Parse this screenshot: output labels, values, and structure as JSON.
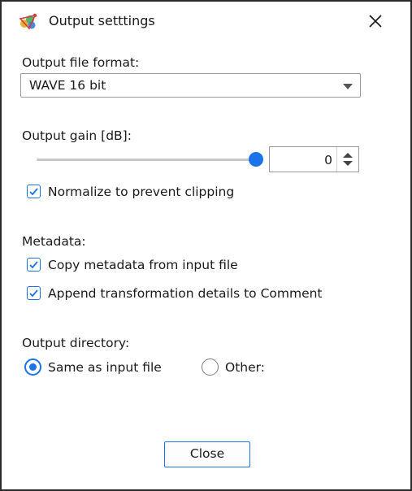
{
  "window": {
    "title": "Output setttings"
  },
  "output_format": {
    "label": "Output file format:",
    "selected": "WAVE 16 bit"
  },
  "output_gain": {
    "label": "Output gain [dB]:",
    "value": "0",
    "slider_fraction": 1.0
  },
  "normalize": {
    "label": "Normalize to prevent clipping",
    "checked": true
  },
  "metadata": {
    "label": "Metadata:",
    "copy": {
      "label": "Copy metadata from input file",
      "checked": true
    },
    "append": {
      "label": "Append transformation details to Comment",
      "checked": true
    }
  },
  "output_directory": {
    "label": "Output directory:",
    "options": [
      {
        "label": "Same as input file",
        "selected": true
      },
      {
        "label": "Other:",
        "selected": false
      }
    ]
  },
  "footer": {
    "close_label": "Close"
  },
  "colors": {
    "accent": "#1a73e8",
    "border": "#2b2b2b"
  }
}
